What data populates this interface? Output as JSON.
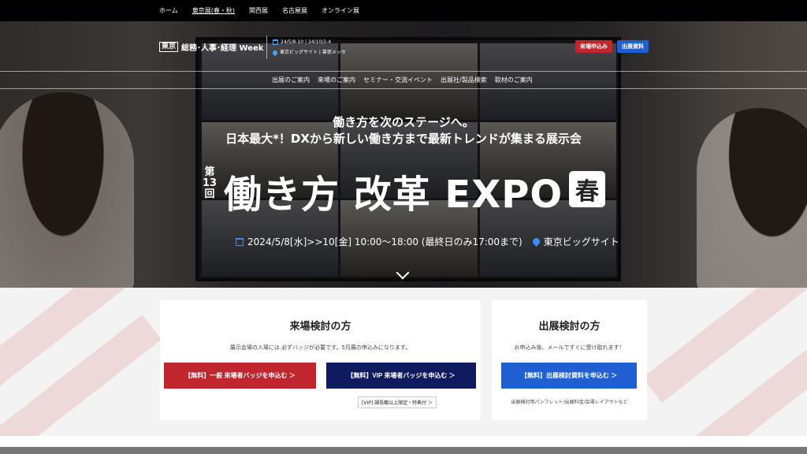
{
  "topnav": {
    "items": [
      {
        "label": "ホーム"
      },
      {
        "label": "東京展(春・秋)"
      },
      {
        "label": "関西展"
      },
      {
        "label": "名古屋展"
      },
      {
        "label": "オンライン展"
      }
    ]
  },
  "header": {
    "brand_box": "東京",
    "brand_name": "総務･人事･経理 Week",
    "dates": "24/5/8-10 | 24/10/2-4",
    "venue": "東京ビッグサイト | 幕張メッセ",
    "btn_visit": "来場申込み",
    "btn_docs": "出展資料"
  },
  "mainmenu": {
    "items": [
      {
        "label": "出展のご案内"
      },
      {
        "label": "来場のご案内"
      },
      {
        "label": "セミナー・交流イベント"
      },
      {
        "label": "出展社/製品検索"
      },
      {
        "label": "取材のご案内"
      }
    ]
  },
  "hero": {
    "tagline1": "働き方を次のステージへ。",
    "tagline2": "日本最大*！DXから新しい働き方まで最新トレンドが集まる展示会",
    "edition": "第13回",
    "title": "働き方 改革 EXPO",
    "season": "春",
    "date_text": "2024/5/8[水]>>10[金] 10:00～18:00 (最終日のみ17:00まで)",
    "venue_text": "東京ビッグサイト"
  },
  "visit_card": {
    "title": "来場検討の方",
    "note": "展示会場の入場には 必ずバッジが必要です。5月展の申込みになります。",
    "btn_general": "【無料】一般 来場者バッジを申込む ＞",
    "btn_vip": "【無料】VIP 来場者バッジを申込む ＞",
    "vip_link": "[VIP] 課長職以上限定・特典付 ＞"
  },
  "exhibit_card": {
    "title": "出展検討の方",
    "note": "お申込み後、メールですぐに受け取れます！",
    "btn": "【無料】出展検討資料を申込む ＞",
    "foot": "出展検討用パンフレット/出展料金/会場レイアウトなど"
  },
  "colors": {
    "red": "#c0262b",
    "navy": "#101a5e",
    "blue": "#1f5fd1"
  }
}
